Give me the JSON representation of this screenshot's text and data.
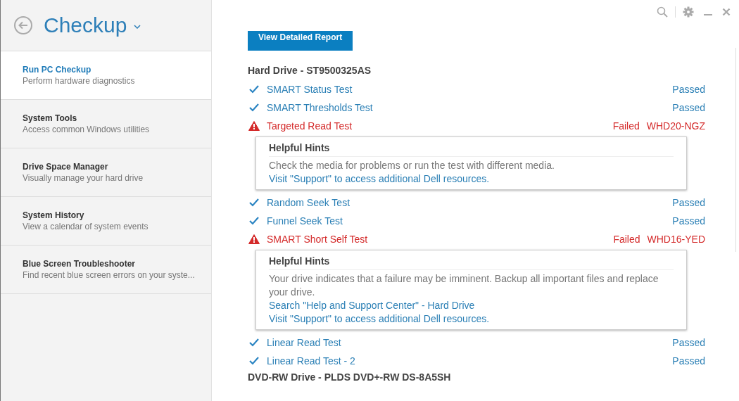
{
  "app": {
    "title": "Checkup"
  },
  "sidebar": {
    "items": [
      {
        "title": "Run PC Checkup",
        "subtitle": "Perform hardware diagnostics",
        "selected": true
      },
      {
        "title": "System Tools",
        "subtitle": "Access common Windows utilities",
        "selected": false
      },
      {
        "title": "Drive Space Manager",
        "subtitle": "Visually manage your hard drive",
        "selected": false
      },
      {
        "title": "System History",
        "subtitle": "View a calendar of system events",
        "selected": false
      },
      {
        "title": "Blue Screen Troubleshooter",
        "subtitle": "Find recent blue screen errors on your syste...",
        "selected": false
      }
    ]
  },
  "report_button": "View Detailed Report",
  "sections": [
    {
      "title": "Hard Drive - ST9500325AS",
      "tests": [
        {
          "kind": "pass",
          "name": "SMART Status Test",
          "result": "Passed"
        },
        {
          "kind": "pass",
          "name": "SMART Thresholds Test",
          "result": "Passed"
        },
        {
          "kind": "fail",
          "name": "Targeted Read Test",
          "result": "Failed",
          "code": "WHD20-NGZ",
          "hint": {
            "title": "Helpful Hints",
            "lines": [
              {
                "kind": "text",
                "text": "Check the media for problems or run the test with different media."
              },
              {
                "kind": "link",
                "text": "Visit \"Support\" to access additional Dell resources."
              }
            ]
          }
        },
        {
          "kind": "pass",
          "name": "Random Seek Test",
          "result": "Passed"
        },
        {
          "kind": "pass",
          "name": "Funnel Seek Test",
          "result": "Passed"
        },
        {
          "kind": "fail",
          "name": "SMART Short Self Test",
          "result": "Failed",
          "code": "WHD16-YED",
          "hint": {
            "title": "Helpful Hints",
            "lines": [
              {
                "kind": "text",
                "text": "Your drive indicates that a failure may be imminent. Backup all important files and replace your drive."
              },
              {
                "kind": "link",
                "text": "Search \"Help and Support Center\" - Hard Drive"
              },
              {
                "kind": "link",
                "text": "Visit \"Support\" to access additional Dell resources."
              }
            ]
          }
        },
        {
          "kind": "pass",
          "name": "Linear Read Test",
          "result": "Passed"
        },
        {
          "kind": "pass",
          "name": "Linear Read Test - 2",
          "result": "Passed"
        }
      ]
    },
    {
      "title": "DVD-RW Drive - PLDS DVD+-RW DS-8A5SH"
    }
  ]
}
